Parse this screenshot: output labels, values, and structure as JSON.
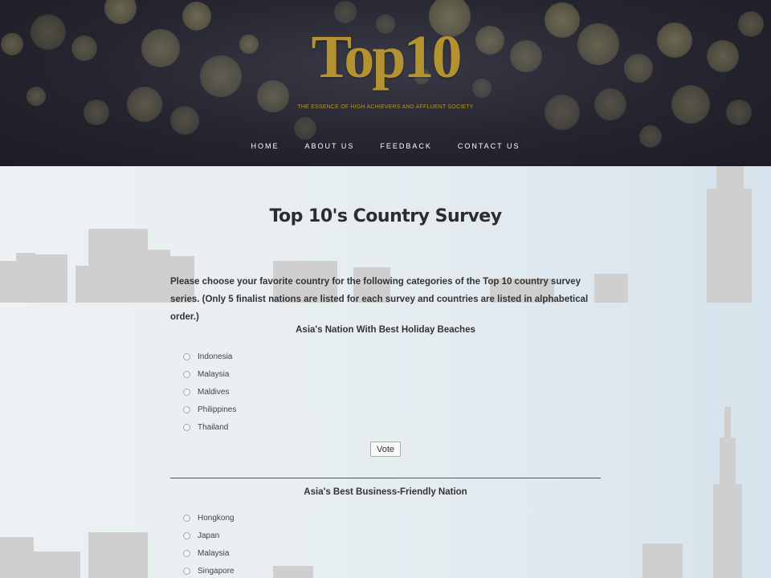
{
  "header": {
    "logo": "Top10",
    "tagline": "THE ESSENCE OF HIGH ACHIEVERS AND AFFLUENT SOCIETY",
    "nav": [
      "HOME",
      "ABOUT US",
      "FEEDBACK",
      "CONTACT US"
    ]
  },
  "main": {
    "title": "Top 10's Country Survey",
    "intro": "Please choose your favorite country for the following categories of the Top 10 country survey series. (Only 5 finalist nations are listed for each survey and countries are listed in alphabetical order.)",
    "surveys": [
      {
        "question": "Asia's Nation With Best Holiday Beaches",
        "options": [
          "Indonesia",
          "Malaysia",
          "Maldives",
          "Philippines",
          "Thailand"
        ],
        "vote_label": "Vote"
      },
      {
        "question": "Asia's Best Business-Friendly Nation",
        "options": [
          "Hongkong",
          "Japan",
          "Malaysia",
          "Singapore"
        ]
      }
    ]
  },
  "colors": {
    "gold": "#b4922f",
    "header_bg": "#252530",
    "skyline": "#cfcfcf"
  }
}
